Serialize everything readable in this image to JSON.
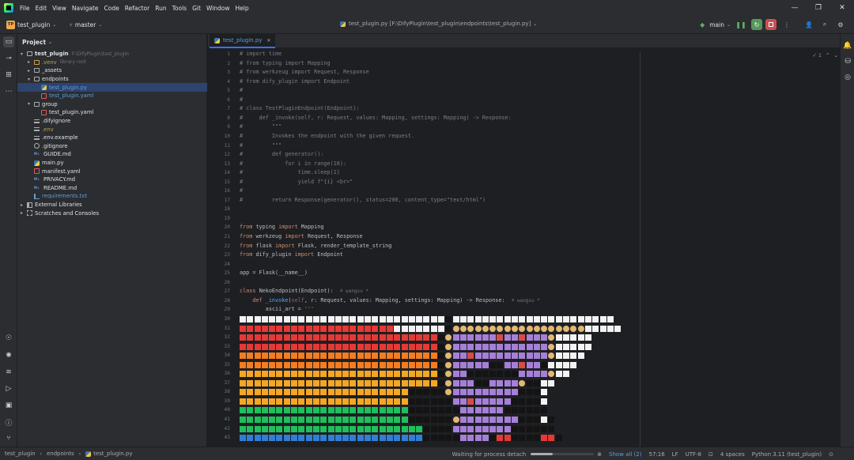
{
  "menu": [
    "File",
    "Edit",
    "View",
    "Navigate",
    "Code",
    "Refactor",
    "Run",
    "Tools",
    "Git",
    "Window",
    "Help"
  ],
  "toolbar": {
    "project_avatar": "TP",
    "project_name": "test_plugin",
    "branch": "master",
    "file_path_title": "test_plugin.py [F:\\DifyPlugin\\test_plugin\\endpoints\\test_plugin.py]",
    "run_config": "main"
  },
  "project_panel": {
    "title": "Project",
    "tree": [
      {
        "label": "test_plugin",
        "hint": "F:\\DifyPlugin\\test_plugin",
        "depth": 0,
        "arrow": "▾",
        "icon": "folder",
        "color": "normal",
        "bold": true
      },
      {
        "label": ".venv",
        "hint": "library root",
        "depth": 1,
        "arrow": "▸",
        "icon": "folder-ex",
        "color": "yellow"
      },
      {
        "label": "_assets",
        "depth": 1,
        "arrow": "▸",
        "icon": "folder",
        "color": "normal"
      },
      {
        "label": "endpoints",
        "depth": 1,
        "arrow": "▾",
        "icon": "folder",
        "color": "normal"
      },
      {
        "label": "test_plugin.py",
        "depth": 2,
        "arrow": "",
        "icon": "py",
        "color": "blue",
        "selected": true
      },
      {
        "label": "test_plugin.yaml",
        "depth": 2,
        "arrow": "",
        "icon": "yaml",
        "color": "blue"
      },
      {
        "label": "group",
        "depth": 1,
        "arrow": "▾",
        "icon": "folder",
        "color": "normal"
      },
      {
        "label": "test_plugin.yaml",
        "depth": 2,
        "arrow": "",
        "icon": "yaml",
        "color": "normal"
      },
      {
        "label": ".difyignore",
        "depth": 1,
        "arrow": "",
        "icon": "env",
        "color": "normal"
      },
      {
        "label": ".env",
        "depth": 1,
        "arrow": "",
        "icon": "env",
        "color": "yellow"
      },
      {
        "label": ".env.example",
        "depth": 1,
        "arrow": "",
        "icon": "env",
        "color": "normal"
      },
      {
        "label": ".gitignore",
        "depth": 1,
        "arrow": "",
        "icon": "circle",
        "color": "normal"
      },
      {
        "label": "GUIDE.md",
        "depth": 1,
        "arrow": "",
        "icon": "md",
        "color": "normal"
      },
      {
        "label": "main.py",
        "depth": 1,
        "arrow": "",
        "icon": "py",
        "color": "normal"
      },
      {
        "label": "manifest.yaml",
        "depth": 1,
        "arrow": "",
        "icon": "yaml",
        "color": "normal"
      },
      {
        "label": "PRIVACY.md",
        "depth": 1,
        "arrow": "",
        "icon": "md",
        "color": "normal"
      },
      {
        "label": "README.md",
        "depth": 1,
        "arrow": "",
        "icon": "md",
        "color": "normal"
      },
      {
        "label": "requirements.txt",
        "depth": 1,
        "arrow": "",
        "icon": "txt",
        "color": "blue"
      },
      {
        "label": "External Libraries",
        "depth": 0,
        "arrow": "▸",
        "icon": "lib",
        "color": "normal"
      },
      {
        "label": "Scratches and Consoles",
        "depth": 0,
        "arrow": "▸",
        "icon": "scratch",
        "color": "normal"
      }
    ]
  },
  "editor": {
    "tab_label": "test_plugin.py",
    "inspections": "✓ 1",
    "lines": [
      [
        [
          "cm",
          "# import time"
        ]
      ],
      [
        [
          "cm",
          "# from typing import Mapping"
        ]
      ],
      [
        [
          "cm",
          "# from werkzeug import Request, Response"
        ]
      ],
      [
        [
          "cm",
          "# from dify_plugin import Endpoint"
        ]
      ],
      [
        [
          "cm",
          "#"
        ]
      ],
      [
        [
          "cm",
          "#"
        ]
      ],
      [
        [
          "cm",
          "# class TestPluginEndpoint(Endpoint):"
        ]
      ],
      [
        [
          "cm",
          "#     def _invoke(self, r: Request, values: Mapping, settings: Mapping) -> Response:"
        ]
      ],
      [
        [
          "cm",
          "#         \"\"\""
        ]
      ],
      [
        [
          "cm",
          "#         Invokes the endpoint with the given request."
        ]
      ],
      [
        [
          "cm",
          "#         \"\"\""
        ]
      ],
      [
        [
          "cm",
          "#         def generator():"
        ]
      ],
      [
        [
          "cm",
          "#             for i in range(10):"
        ]
      ],
      [
        [
          "cm",
          "#                 time.sleep(1)"
        ]
      ],
      [
        [
          "cm",
          "#                 yield f\"{i} <br>\""
        ]
      ],
      [
        [
          "cm",
          "#"
        ]
      ],
      [
        [
          "cm",
          "#         return Response(generator(), status=200, content_type=\"text/html\")"
        ]
      ],
      [
        [
          "",
          ""
        ]
      ],
      [
        [
          "",
          ""
        ]
      ],
      [
        [
          "kw",
          "from "
        ],
        [
          "",
          "typing "
        ],
        [
          "kw",
          "import "
        ],
        [
          "",
          "Mapping"
        ]
      ],
      [
        [
          "kw",
          "from "
        ],
        [
          "",
          "werkzeug "
        ],
        [
          "kw",
          "import "
        ],
        [
          "",
          "Request, Response"
        ]
      ],
      [
        [
          "kw",
          "from "
        ],
        [
          "",
          "flask "
        ],
        [
          "kw",
          "import "
        ],
        [
          "",
          "Flask, render_template_string"
        ]
      ],
      [
        [
          "kw",
          "from "
        ],
        [
          "",
          "dify_plugin "
        ],
        [
          "kw",
          "import "
        ],
        [
          "",
          "Endpoint"
        ]
      ],
      [
        [
          "",
          ""
        ]
      ],
      [
        [
          "",
          "app = Flask(__name__)"
        ]
      ],
      [
        [
          "",
          ""
        ]
      ],
      [
        [
          "kw",
          "class "
        ],
        [
          "",
          "NekoEndpoint(Endpoint):  "
        ],
        [
          "hint",
          "≗ wangsu *"
        ]
      ],
      [
        [
          "",
          "    "
        ],
        [
          "kw",
          "def "
        ],
        [
          "fn",
          "_invoke"
        ],
        [
          "",
          "("
        ],
        [
          "sf",
          "self"
        ],
        [
          "",
          ", r: Request, values: Mapping, settings: Mapping) -> Response:  "
        ],
        [
          "hint",
          "≗ wangsu *"
        ]
      ],
      [
        [
          "",
          "        ascii_art = "
        ],
        [
          "st",
          "'''"
        ]
      ]
    ],
    "ascii_start_line": 30,
    "ascii_rows": [
      "WWWWWWWWWWWWWWWWWWWWWWWWWWWWKWWWWWWWWWWWWWWWWWWWWWW",
      "RRRRRRRRRRRRRRRRRRRRRWWWWWWWKCCCCCCCCCCCCCCCCCCWWWWW",
      "RRRRRRRRRRRRRRRRRRRRRRRRRRRKCPPPPPPSPPSPPPCWWWWW",
      "RRRRRRRRRRRRRRRRRRRRRRRRRRRKCPPPPPPPPPPPPPCWWWWW",
      "OOOOOOOOOOOOOOOOOOOOOOOOOOOKCPPSPPPPPPPPPPCWWWW",
      "OOOOOOOOOOOOOOOOOOOOOOOOOOOKCPPPPPKKPPSPPKWWWW",
      "YYYYYYYYYYYYYYYYYYYYYYYYYYYKCPPKKKKKKKPPPPCWW",
      "YYYYYYYYYYYYYYYYYYYYYYYYYYYKCPPPKKPPPPCKKWW",
      "YYYYYYYYYYYYYYYYYYYYYYYKKKKKCPPPPPPPPPKKKW",
      "YYYYYYYYYYYYYYYYYYYYYYYKKKKKKPPSPPPPPKKKKW",
      "GGGGGGGGGGGGGGGGGGGGGGGKKKKKKKPPPPPPKKKKKK",
      "GGGGGGGGGGGGGGGGGGGGGGGKKKKKKCPPPPPPPPKKKWK",
      "GGGGGGGGGGGGGGGGGGGGGGGGGKKKKPPPPPPPPKKKKKK",
      "BBBBBBBBBBBBBBBBBBBBBBBBBKKKKKPPPPKRRKKKKRRK"
    ],
    "palette": {
      "W": "#f3f3f3",
      "K": "#141414",
      "R": "#e53935",
      "O": "#f57c1f",
      "Y": "#f5a623",
      "G": "#1fbf5c",
      "B": "#2f7fd6",
      "C": "#e2b872",
      "P": "#a57fd8",
      "S": "#d94b4b"
    }
  },
  "status": {
    "breadcrumbs": [
      "test_plugin",
      "endpoints",
      "test_plugin.py"
    ],
    "process": "Waiting for process detach",
    "progress_fraction": 0.35,
    "show_all": "Show all (2)",
    "position": "57:16",
    "line_sep": "LF",
    "encoding": "UTF-8",
    "indent": "4 spaces",
    "interpreter": "Python 3.11 (test_plugin)"
  },
  "colors": {
    "accent": "#3574f0",
    "selection": "#2e436e",
    "run_green": "#57965c",
    "stop_red": "#c94f4f"
  }
}
